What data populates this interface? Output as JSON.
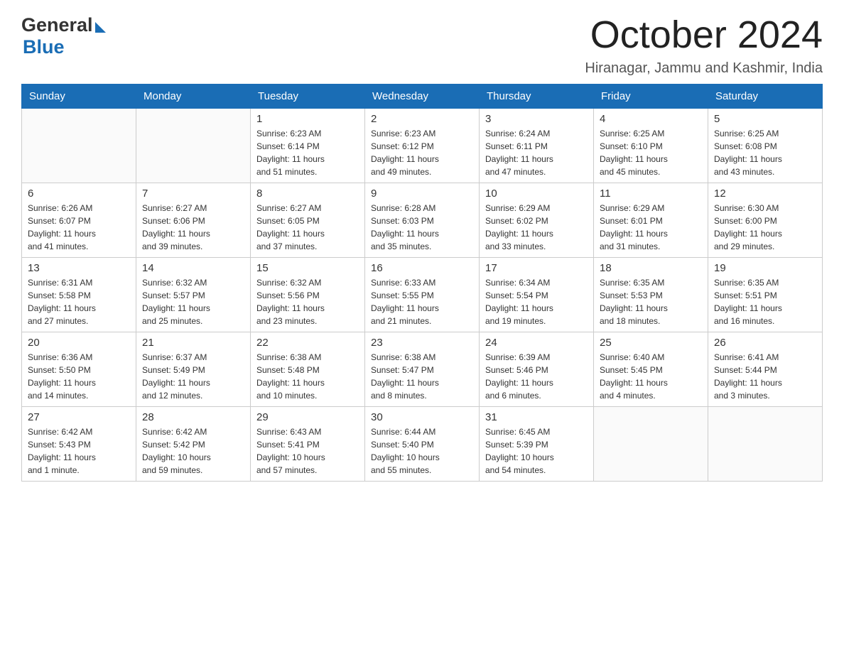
{
  "logo": {
    "general": "General",
    "blue": "Blue",
    "tagline": "GeneralBlue"
  },
  "title": {
    "month_year": "October 2024",
    "location": "Hiranagar, Jammu and Kashmir, India"
  },
  "headers": [
    "Sunday",
    "Monday",
    "Tuesday",
    "Wednesday",
    "Thursday",
    "Friday",
    "Saturday"
  ],
  "weeks": [
    [
      {
        "day": "",
        "info": ""
      },
      {
        "day": "",
        "info": ""
      },
      {
        "day": "1",
        "info": "Sunrise: 6:23 AM\nSunset: 6:14 PM\nDaylight: 11 hours\nand 51 minutes."
      },
      {
        "day": "2",
        "info": "Sunrise: 6:23 AM\nSunset: 6:12 PM\nDaylight: 11 hours\nand 49 minutes."
      },
      {
        "day": "3",
        "info": "Sunrise: 6:24 AM\nSunset: 6:11 PM\nDaylight: 11 hours\nand 47 minutes."
      },
      {
        "day": "4",
        "info": "Sunrise: 6:25 AM\nSunset: 6:10 PM\nDaylight: 11 hours\nand 45 minutes."
      },
      {
        "day": "5",
        "info": "Sunrise: 6:25 AM\nSunset: 6:08 PM\nDaylight: 11 hours\nand 43 minutes."
      }
    ],
    [
      {
        "day": "6",
        "info": "Sunrise: 6:26 AM\nSunset: 6:07 PM\nDaylight: 11 hours\nand 41 minutes."
      },
      {
        "day": "7",
        "info": "Sunrise: 6:27 AM\nSunset: 6:06 PM\nDaylight: 11 hours\nand 39 minutes."
      },
      {
        "day": "8",
        "info": "Sunrise: 6:27 AM\nSunset: 6:05 PM\nDaylight: 11 hours\nand 37 minutes."
      },
      {
        "day": "9",
        "info": "Sunrise: 6:28 AM\nSunset: 6:03 PM\nDaylight: 11 hours\nand 35 minutes."
      },
      {
        "day": "10",
        "info": "Sunrise: 6:29 AM\nSunset: 6:02 PM\nDaylight: 11 hours\nand 33 minutes."
      },
      {
        "day": "11",
        "info": "Sunrise: 6:29 AM\nSunset: 6:01 PM\nDaylight: 11 hours\nand 31 minutes."
      },
      {
        "day": "12",
        "info": "Sunrise: 6:30 AM\nSunset: 6:00 PM\nDaylight: 11 hours\nand 29 minutes."
      }
    ],
    [
      {
        "day": "13",
        "info": "Sunrise: 6:31 AM\nSunset: 5:58 PM\nDaylight: 11 hours\nand 27 minutes."
      },
      {
        "day": "14",
        "info": "Sunrise: 6:32 AM\nSunset: 5:57 PM\nDaylight: 11 hours\nand 25 minutes."
      },
      {
        "day": "15",
        "info": "Sunrise: 6:32 AM\nSunset: 5:56 PM\nDaylight: 11 hours\nand 23 minutes."
      },
      {
        "day": "16",
        "info": "Sunrise: 6:33 AM\nSunset: 5:55 PM\nDaylight: 11 hours\nand 21 minutes."
      },
      {
        "day": "17",
        "info": "Sunrise: 6:34 AM\nSunset: 5:54 PM\nDaylight: 11 hours\nand 19 minutes."
      },
      {
        "day": "18",
        "info": "Sunrise: 6:35 AM\nSunset: 5:53 PM\nDaylight: 11 hours\nand 18 minutes."
      },
      {
        "day": "19",
        "info": "Sunrise: 6:35 AM\nSunset: 5:51 PM\nDaylight: 11 hours\nand 16 minutes."
      }
    ],
    [
      {
        "day": "20",
        "info": "Sunrise: 6:36 AM\nSunset: 5:50 PM\nDaylight: 11 hours\nand 14 minutes."
      },
      {
        "day": "21",
        "info": "Sunrise: 6:37 AM\nSunset: 5:49 PM\nDaylight: 11 hours\nand 12 minutes."
      },
      {
        "day": "22",
        "info": "Sunrise: 6:38 AM\nSunset: 5:48 PM\nDaylight: 11 hours\nand 10 minutes."
      },
      {
        "day": "23",
        "info": "Sunrise: 6:38 AM\nSunset: 5:47 PM\nDaylight: 11 hours\nand 8 minutes."
      },
      {
        "day": "24",
        "info": "Sunrise: 6:39 AM\nSunset: 5:46 PM\nDaylight: 11 hours\nand 6 minutes."
      },
      {
        "day": "25",
        "info": "Sunrise: 6:40 AM\nSunset: 5:45 PM\nDaylight: 11 hours\nand 4 minutes."
      },
      {
        "day": "26",
        "info": "Sunrise: 6:41 AM\nSunset: 5:44 PM\nDaylight: 11 hours\nand 3 minutes."
      }
    ],
    [
      {
        "day": "27",
        "info": "Sunrise: 6:42 AM\nSunset: 5:43 PM\nDaylight: 11 hours\nand 1 minute."
      },
      {
        "day": "28",
        "info": "Sunrise: 6:42 AM\nSunset: 5:42 PM\nDaylight: 10 hours\nand 59 minutes."
      },
      {
        "day": "29",
        "info": "Sunrise: 6:43 AM\nSunset: 5:41 PM\nDaylight: 10 hours\nand 57 minutes."
      },
      {
        "day": "30",
        "info": "Sunrise: 6:44 AM\nSunset: 5:40 PM\nDaylight: 10 hours\nand 55 minutes."
      },
      {
        "day": "31",
        "info": "Sunrise: 6:45 AM\nSunset: 5:39 PM\nDaylight: 10 hours\nand 54 minutes."
      },
      {
        "day": "",
        "info": ""
      },
      {
        "day": "",
        "info": ""
      }
    ]
  ]
}
